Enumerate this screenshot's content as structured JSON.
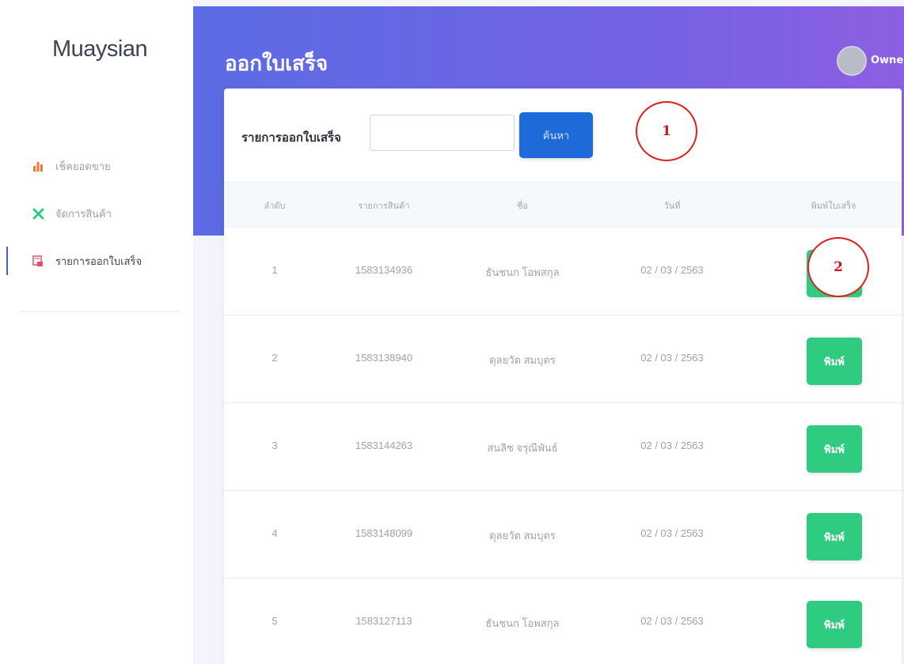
{
  "brand": "Muaysian",
  "nav": [
    {
      "label": "เช็คยอดขาย",
      "icon": "bar-chart-icon",
      "color": "#f07a2e"
    },
    {
      "label": "จัดการสินค้า",
      "icon": "tools-icon",
      "color": "#2ecb80"
    },
    {
      "label": "รายการออกใบเสร็จ",
      "icon": "receipt-icon",
      "color": "#e8506a",
      "active": true
    }
  ],
  "header": {
    "title": "ออกใบเสร็จ",
    "user": "Owner"
  },
  "search": {
    "label": "รายการออกใบเสร็จ",
    "value": "",
    "button": "ค้นหา"
  },
  "table": {
    "columns": [
      "ลำดับ",
      "รายการสินค้า",
      "ชื่อ",
      "วันที่",
      "พิมพ์ใบเสร็จ"
    ],
    "rows": [
      {
        "no": "1",
        "item": "1583134936",
        "name": "ธันชนก โอพสกุล",
        "date": "02 / 03 / 2563",
        "action": "พิมพ์"
      },
      {
        "no": "2",
        "item": "1583138940",
        "name": "ดุลยวัต สมบุตร",
        "date": "02 / 03 / 2563",
        "action": "พิมพ์"
      },
      {
        "no": "3",
        "item": "1583144263",
        "name": "สนลิช จรุณีพันธ์",
        "date": "02 / 03 / 2563",
        "action": "พิมพ์"
      },
      {
        "no": "4",
        "item": "1583148099",
        "name": "ดุลยวัต สมบุตร",
        "date": "02 / 03 / 2563",
        "action": "พิมพ์"
      },
      {
        "no": "5",
        "item": "1583127113",
        "name": "ธันชนก โอพสกุล",
        "date": "02 / 03 / 2563",
        "action": "พิมพ์"
      }
    ]
  },
  "callouts": [
    "1",
    "2"
  ],
  "colors": {
    "accent": "#1e6ad8",
    "success": "#2ecb80",
    "gradient_start": "#5b6be3",
    "gradient_end": "#8d5fe2",
    "callout": "#e01e1e"
  }
}
